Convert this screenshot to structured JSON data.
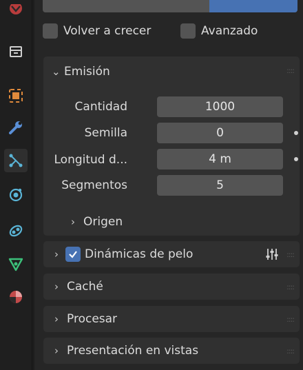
{
  "checkboxes": {
    "regrow": {
      "label": "Volver a crecer",
      "checked": false
    },
    "advanced": {
      "label": "Avanzado",
      "checked": false
    }
  },
  "emission": {
    "title": "Emisión",
    "rows": [
      {
        "label": "Cantidad",
        "value": "1000"
      },
      {
        "label": "Semilla",
        "value": "0"
      },
      {
        "label": "Longitud d...",
        "value": "4 m"
      },
      {
        "label": "Segmentos",
        "value": "5"
      }
    ],
    "origin": "Origen"
  },
  "panels": {
    "hair_dynamics": {
      "label": "Dinámicas de pelo",
      "enabled": true
    },
    "cache": "Caché",
    "render": "Procesar",
    "viewport_display": "Presentación en vistas"
  },
  "sidebar_icons": [
    "world-icon",
    "collection-icon",
    "object-icon",
    "modifier-wrench-icon",
    "particles-icon",
    "physics-icon",
    "constraints-icon",
    "data-icon",
    "material-icon"
  ],
  "colors": {
    "accent": "#4772b3",
    "panel": "#303030",
    "field": "#545454"
  }
}
